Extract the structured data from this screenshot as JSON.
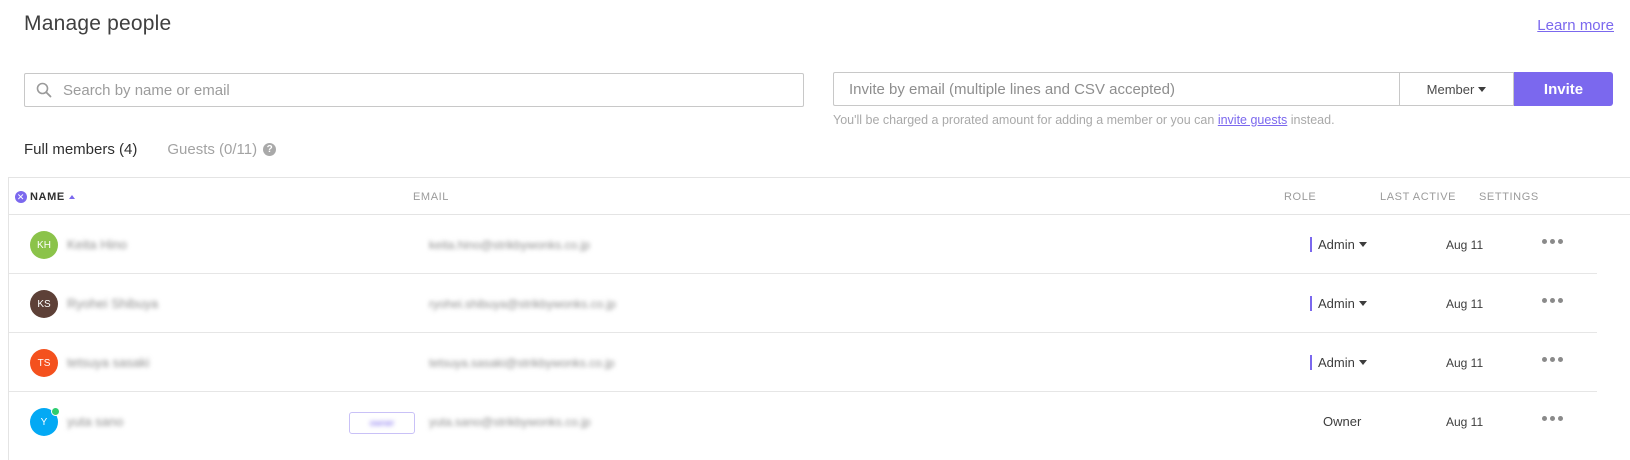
{
  "page": {
    "title": "Manage people",
    "learn_more": "Learn more"
  },
  "search": {
    "placeholder": "Search by name or email",
    "value": ""
  },
  "invite": {
    "placeholder": "Invite by email (multiple lines and CSV accepted)",
    "role_label": "Member",
    "button_label": "Invite",
    "note_before": "You'll be charged a prorated amount for adding a member or you can ",
    "note_link": "invite guests",
    "note_after": " instead."
  },
  "tabs": {
    "members": "Full members (4)",
    "guests": "Guests (0/11)",
    "help_glyph": "?"
  },
  "table": {
    "headers": {
      "name": "NAME",
      "email": "EMAIL",
      "role": "ROLE",
      "last_active": "LAST ACTIVE",
      "settings": "SETTINGS"
    },
    "clear_glyph": "✕",
    "rows": [
      {
        "initials": "KH",
        "avatar_color": "#8bc34a",
        "name": "Keita Hino",
        "email": "keita.hino@strikbywonks.co.jp",
        "role": "Admin",
        "last_active": "Aug 11"
      },
      {
        "initials": "KS",
        "avatar_color": "#5d4037",
        "name": "Ryohei Shibuya",
        "email": "ryohei.shibuya@strikbywonks.co.jp",
        "role": "Admin",
        "last_active": "Aug 11"
      },
      {
        "initials": "TS",
        "avatar_color": "#f4511e",
        "name": "tetsuya sasaki",
        "email": "tetsuya.sasaki@strikbywonks.co.jp",
        "role": "Admin",
        "last_active": "Aug 11"
      },
      {
        "initials": "Y",
        "avatar_color": "#03a9f4",
        "name": "yuta sano",
        "email": "yuta.sano@strikbywonks.co.jp",
        "role": "Owner",
        "last_active": "Aug 11",
        "badge": "owner"
      }
    ]
  },
  "colors": {
    "accent": "#7b68ee",
    "online": "#2ecd6f"
  }
}
